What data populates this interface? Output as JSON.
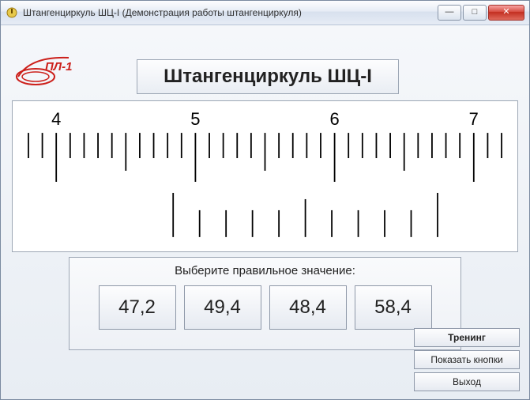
{
  "window": {
    "title": "Штангенциркуль ШЦ-I (Демонстрация работы штангенциркуля)",
    "min": "—",
    "max": "□",
    "close": "✕"
  },
  "logo_text": "ПЛ-1",
  "heading": "Штангенциркуль ШЦ-I",
  "scale": {
    "main_major_labels": [
      "4",
      "5",
      "6",
      "7"
    ],
    "main_start_mm": 38,
    "main_end_mm": 72,
    "vernier_zero_at_mm": 48.4,
    "vernier_divisions": 10
  },
  "quiz": {
    "prompt": "Выберите правильное значение:",
    "answers": [
      "47,2",
      "49,4",
      "48,4",
      "58,4"
    ]
  },
  "side_buttons": {
    "training": "Тренинг",
    "show_buttons": "Показать кнопки",
    "exit": "Выход"
  }
}
